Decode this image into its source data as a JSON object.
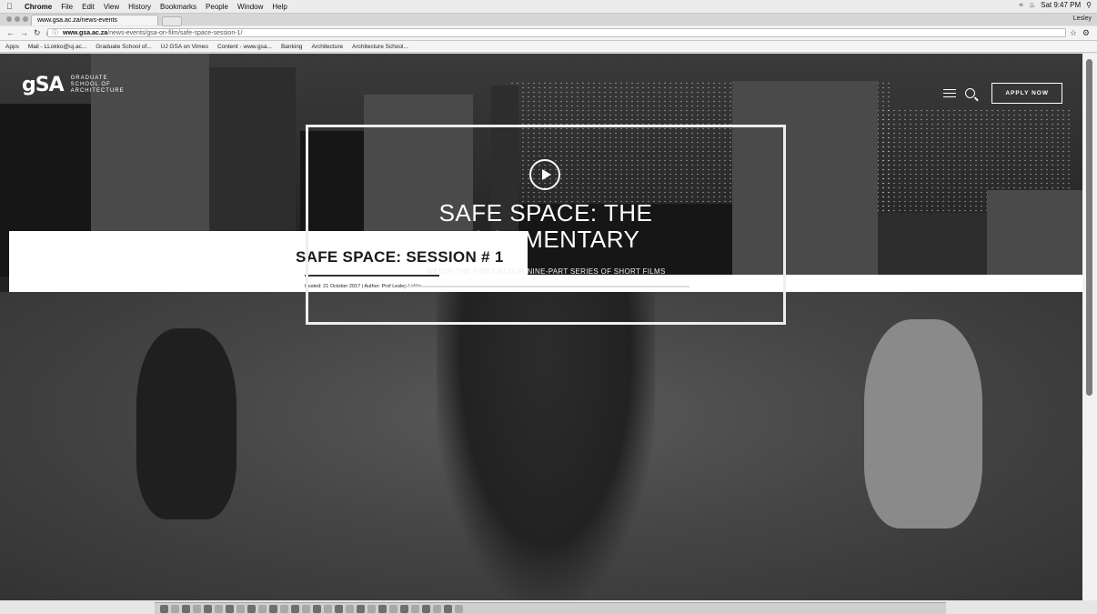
{
  "menubar": {
    "app": "Chrome",
    "items": [
      "File",
      "Edit",
      "View",
      "History",
      "Bookmarks",
      "People",
      "Window",
      "Help"
    ],
    "clock": "Sat 9:47 PM"
  },
  "tab": {
    "title": "www.gsa.ac.za/news-events"
  },
  "profile": "Lesley",
  "address": {
    "host": "www.gsa.ac.za",
    "path": "/news-events/gsa-on-film/safe-space-session-1/"
  },
  "bookmarks": [
    "Apps",
    "Mail - LLokko@uj.ac...",
    "Graduate School of...",
    "UJ GSA on Vimeo",
    "Content - www.gsa...",
    "Banking",
    "Architecture",
    "Architecture School..."
  ],
  "site": {
    "logo_mark": "gSA",
    "logo_lines": [
      "GRADUATE",
      "SCHOOL OF",
      "ARCHITECTURE"
    ],
    "apply_label": "APPLY NOW"
  },
  "article": {
    "title": "SAFE SPACE: SESSION # 1",
    "meta": "Posted: 21 October 2017  |  Author: Prof Lesley Lokko"
  },
  "video": {
    "title": "SAFE SPACE: THE\nDOCUMENTARY",
    "subtitle": "WATCH THE FIRST IN OUR NINE-PART SERIES OF SHORT FILMS"
  }
}
